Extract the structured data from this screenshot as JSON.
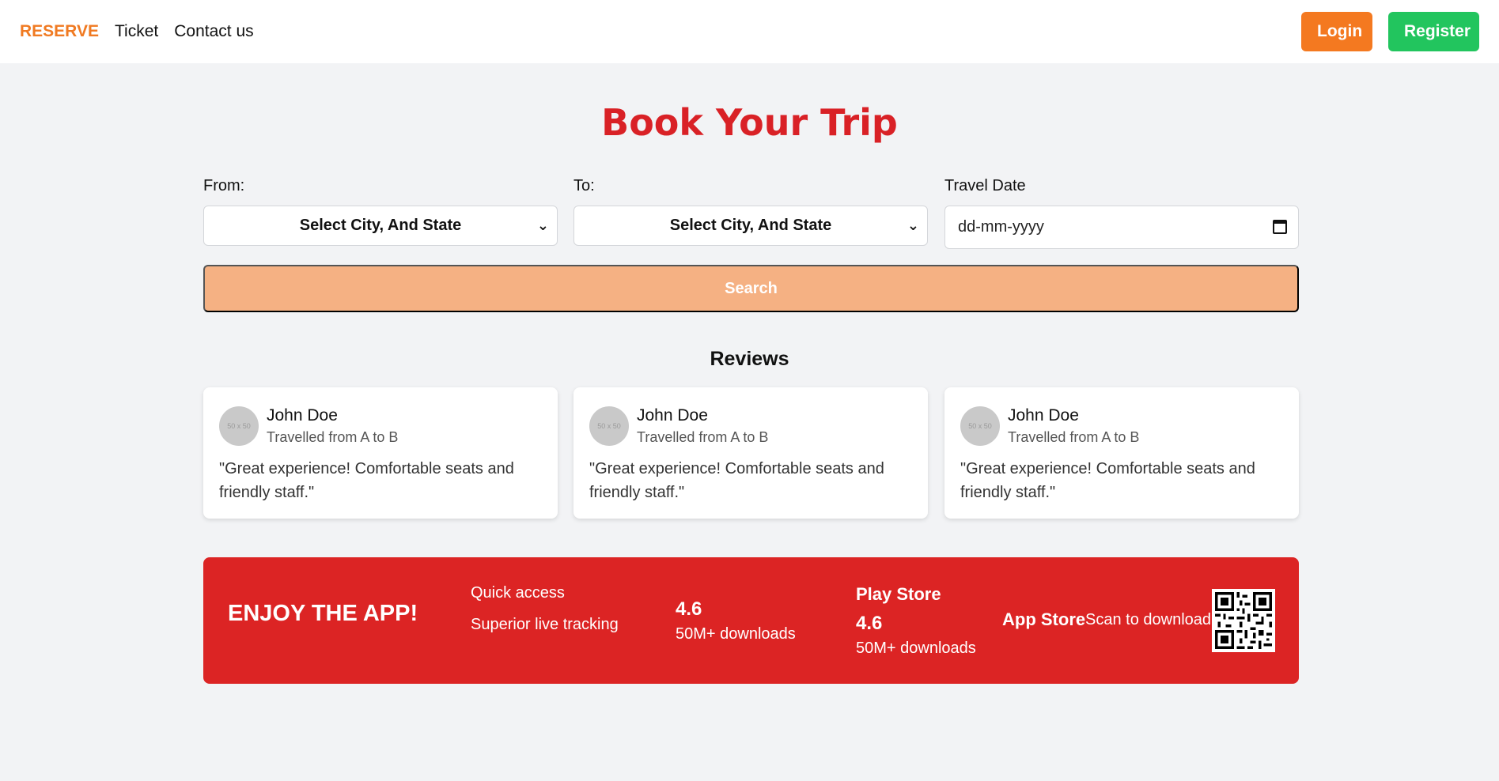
{
  "nav": {
    "brand": "RESERVE",
    "links": [
      "Ticket",
      "Contact us"
    ],
    "login": "Login",
    "register": "Register"
  },
  "hero": {
    "title": "Book Your Trip"
  },
  "form": {
    "from_label": "From:",
    "from_value": "Select City, And State",
    "to_label": "To:",
    "to_value": "Select City, And State",
    "date_label": "Travel Date",
    "date_placeholder": "dd-mm-yyyy",
    "search": "Search"
  },
  "reviews": {
    "title": "Reviews",
    "items": [
      {
        "avatar": "50 x 50",
        "name": "John Doe",
        "route": "Travelled from A to B",
        "quote": "\"Great experience! Comfortable seats and friendly staff.\""
      },
      {
        "avatar": "50 x 50",
        "name": "John Doe",
        "route": "Travelled from A to B",
        "quote": "\"Great experience! Comfortable seats and friendly staff.\""
      },
      {
        "avatar": "50 x 50",
        "name": "John Doe",
        "route": "Travelled from A to B",
        "quote": "\"Great experience! Comfortable seats and friendly staff.\""
      }
    ]
  },
  "promo": {
    "headline": "ENJOY THE APP!",
    "features": [
      "Quick access",
      "Superior live tracking"
    ],
    "stat1": {
      "rating": "4.6",
      "downloads": "50M+ downloads"
    },
    "play_store": {
      "label": "Play Store",
      "rating": "4.6",
      "downloads": "50M+ downloads"
    },
    "app_store": "App Store",
    "scan": "Scan to download"
  },
  "colors": {
    "brand": "#f07a22",
    "title_red": "#d92126",
    "login": "#f47920",
    "register": "#22c55e",
    "search": "#f5b183",
    "promo": "#dc2424"
  }
}
